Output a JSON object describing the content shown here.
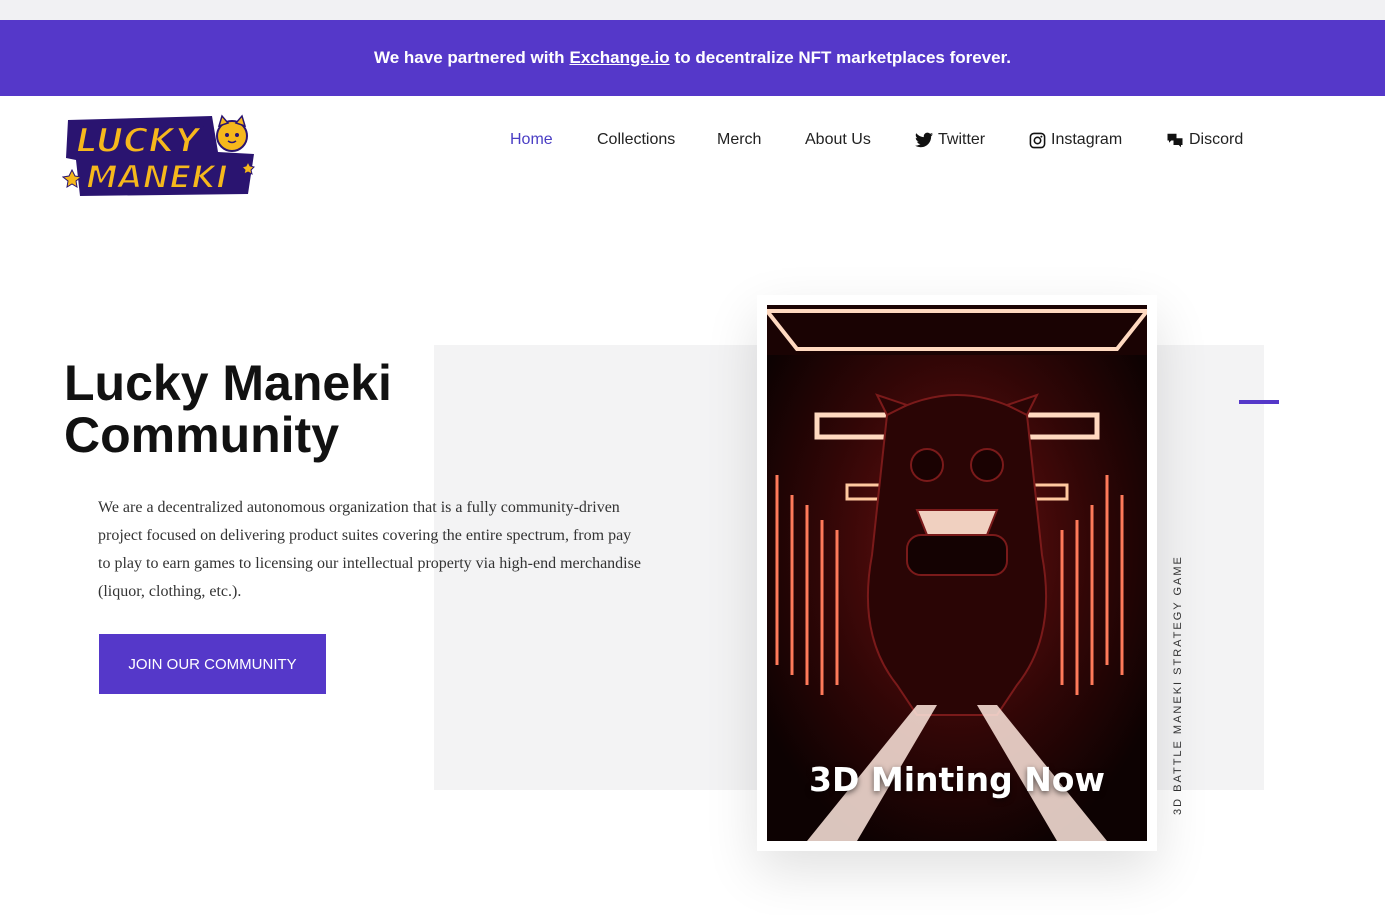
{
  "announcement": {
    "before": "We have partnered with",
    "link": "Exchange.io",
    "after": "to decentralize NFT marketplaces forever."
  },
  "logo": {
    "line1": "LUCKY",
    "line2": "MANEKI"
  },
  "nav": {
    "home": "Home",
    "collections": "Collections",
    "merch": "Merch",
    "about": "About Us",
    "twitter": "Twitter",
    "instagram": "Instagram",
    "discord": "Discord"
  },
  "hero": {
    "title_line1": "Lucky Maneki",
    "title_line2": "Community",
    "description": "We are a decentralized autonomous organization that is a fully community-driven project focused on delivering product suites covering the entire spectrum, from pay to play to earn games to licensing our intellectual property via high-end merchandise (liquor, clothing, etc.).",
    "cta": "JOIN OUR COMMUNITY",
    "card_caption": "3D Minting Now",
    "vertical_label": "3D BATTLE MANEKI STRATEGY GAME"
  },
  "colors": {
    "brand": "#5538c9",
    "active_nav": "#4a3ec4",
    "logo_yellow": "#f6b81c"
  }
}
